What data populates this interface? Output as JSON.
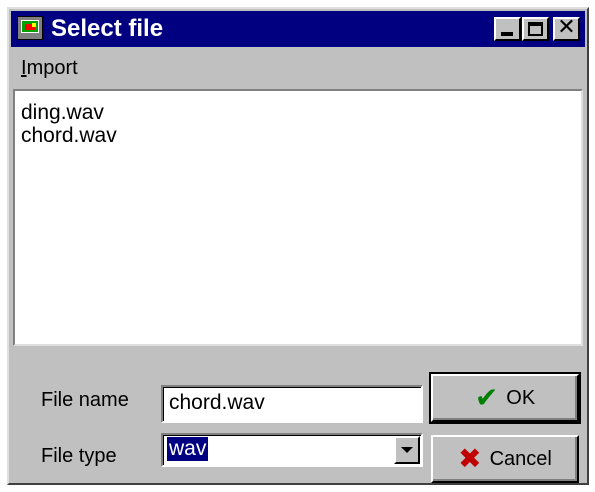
{
  "window": {
    "title": "Select file"
  },
  "titlebar_buttons": {
    "minimize_icon": "minimize-icon",
    "maximize_icon": "maximize-icon",
    "close_icon": "close-icon"
  },
  "menu": {
    "import_accel": "I",
    "import_rest": "mport"
  },
  "files": [
    "ding.wav",
    "chord.wav"
  ],
  "form": {
    "file_name_label": "File name",
    "file_name_value": "chord.wav",
    "file_type_label": "File type",
    "file_type_value": "wav"
  },
  "buttons": {
    "ok_label": "OK",
    "cancel_label": "Cancel",
    "ok_icon": "check-icon",
    "cancel_icon": "x-icon"
  },
  "colors": {
    "titlebar": "#000080",
    "face": "#c0c0c0",
    "selection": "#000080",
    "ok_check": "#008000",
    "cancel_x": "#c00000"
  }
}
